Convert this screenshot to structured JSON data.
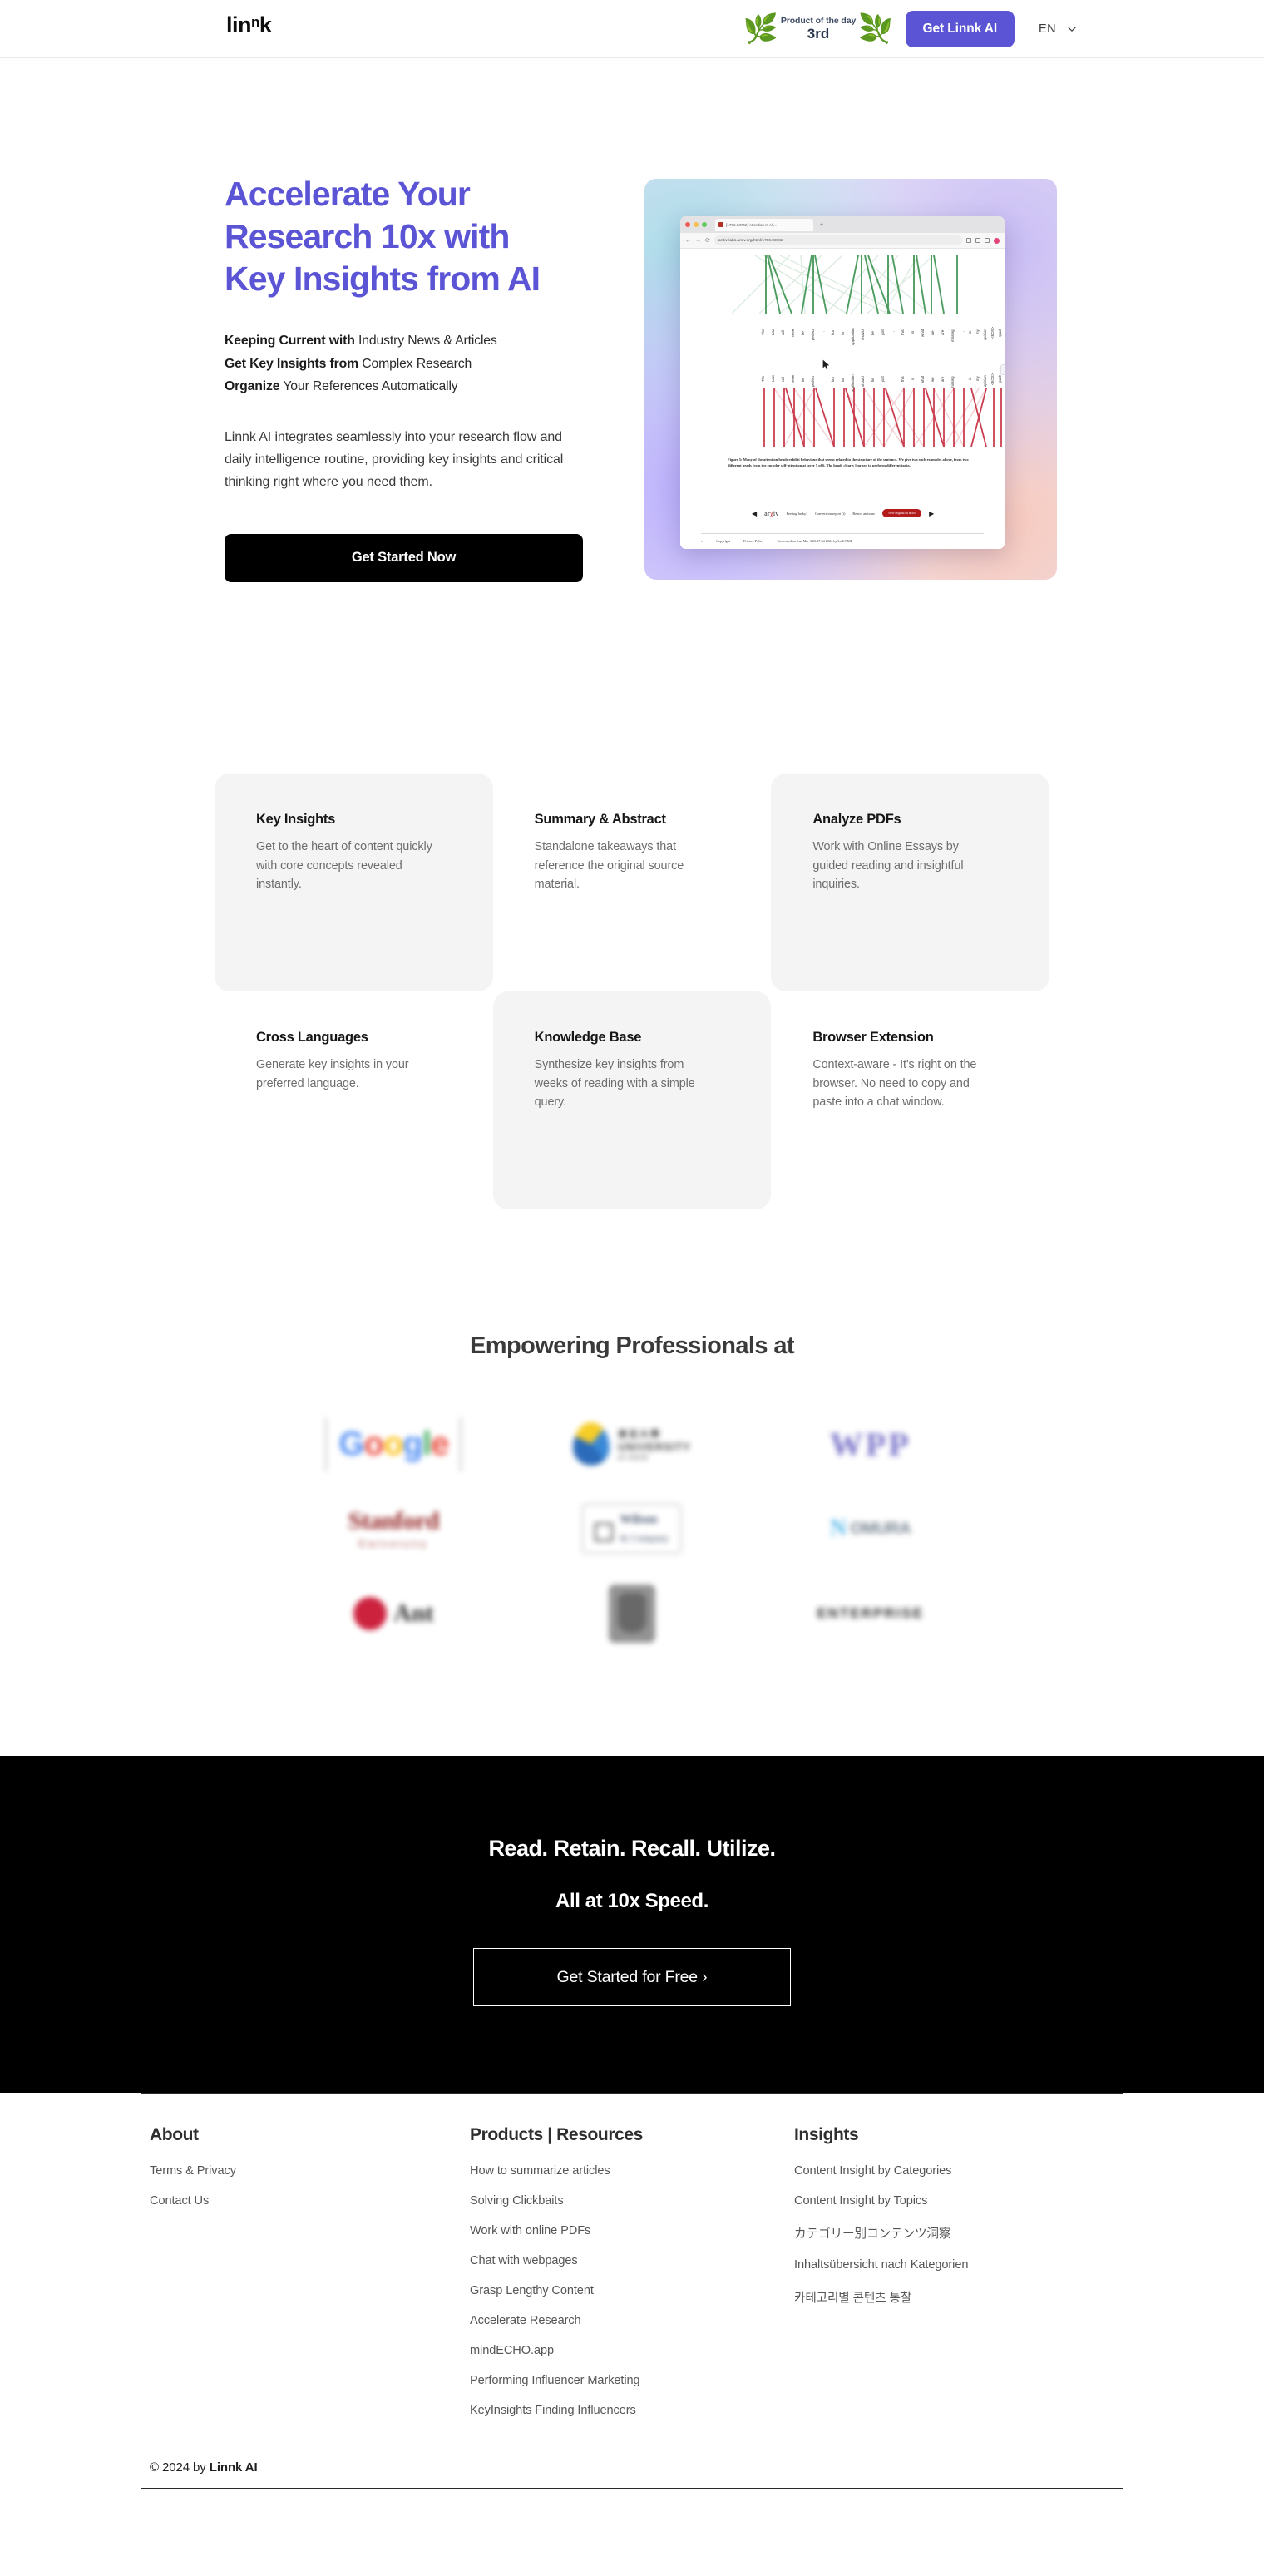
{
  "header": {
    "logo": {
      "pre": "lin",
      "sup": "n",
      "post": "k"
    },
    "badge": {
      "title": "Product of the day",
      "rank": "3rd"
    },
    "cta_label": "Get Linnk AI",
    "lang": "EN",
    "chevron_icon": "chevron-down-icon"
  },
  "hero": {
    "heading_line1": "Accelerate Your",
    "heading_line2": "Research 10x with",
    "heading_line3": "Key Insights from AI",
    "bullets": [
      {
        "bold": "Keeping Current with",
        "rest": " Industry News & Articles"
      },
      {
        "bold": "Get Key Insights from",
        "rest": " Complex Research"
      },
      {
        "bold": "Organize",
        "rest": " Your References Automatically"
      }
    ],
    "body": "Linnk AI integrates seamlessly into your research flow and daily intelligence routine, providing key insights and critical thinking right where you need them.",
    "cta_label": "Get Started Now",
    "screenshot": {
      "tab_title": "[1706.03762] Attention Is All...",
      "url": "arXiv-labs.arxiv.org/html/1706.03762",
      "figure_caption": "Figure 5: Many of the attention heads exhibit behaviour that seems related to the structure of the sentence. We give two such examples above, from two different heads from the encoder self-attention at layer 5 of 6. The heads clearly learned to perform different tasks.",
      "tokens": [
        "The",
        "Law",
        "will",
        "never",
        "be",
        "perfect",
        ",",
        "but",
        "its",
        "application",
        "should",
        "be",
        "just",
        ",",
        "this",
        "is",
        "what",
        "we",
        "are",
        "missing",
        ",",
        "in",
        "my",
        "opinion",
        "<EOS>",
        "<pad>"
      ],
      "arxiv_logo": "arXiv",
      "arxiv_links": [
        "Feeling lucky?",
        "Conversion report (i)",
        "Report an issue"
      ],
      "arxiv_button": "View original on arXiv",
      "footer_links": [
        "Copyright",
        "Privacy Policy",
        "Generated on Sun Mar 3 23:17:54 2024 by LaTeXML"
      ]
    }
  },
  "features": [
    {
      "title": "Key Insights",
      "desc": "Get to the heart of content quickly with core concepts revealed instantly.",
      "shaded": true
    },
    {
      "title": "Summary & Abstract",
      "desc": "Standalone takeaways that reference the original source material.",
      "shaded": false
    },
    {
      "title": "Analyze PDFs",
      "desc": "Work with Online Essays by guided reading and insightful inquiries.",
      "shaded": true
    },
    {
      "title": "Cross Languages",
      "desc": "Generate key insights in your preferred language.",
      "shaded": false
    },
    {
      "title": "Knowledge Base",
      "desc": "Synthesize key insights from weeks of reading with a simple query.",
      "shaded": true
    },
    {
      "title": "Browser Extension",
      "desc": "Context-aware - It's right on the browser. No need to copy and paste into a chat window.",
      "shaded": false
    }
  ],
  "logos_section": {
    "title": "Empowering Professionals at",
    "logos": [
      {
        "name": "google-logo"
      },
      {
        "name": "asia-university-logo"
      },
      {
        "name": "wpp-logo"
      },
      {
        "name": "stanford-university-logo"
      },
      {
        "name": "wilson-logo"
      },
      {
        "name": "nomura-logo"
      },
      {
        "name": "johnson-logo"
      },
      {
        "name": "apple-logo"
      },
      {
        "name": "dark-wordmark-logo"
      }
    ]
  },
  "black_cta": {
    "line1": "Read. Retain. Recall. Utilize.",
    "line2": "All at 10x Speed.",
    "button": "Get Started for Free  ›"
  },
  "footer": {
    "columns": [
      {
        "title": "About",
        "links": [
          "Terms & Privacy",
          "Contact Us"
        ]
      },
      {
        "title": "Products | Resources",
        "links": [
          "How to summarize articles",
          "Solving Clickbaits",
          "Work with online PDFs",
          "Chat with webpages",
          "Grasp Lengthy Content",
          "Accelerate Research",
          "mindECHO.app",
          "Performing Influencer Marketing",
          "KeyInsights Finding Influencers"
        ]
      },
      {
        "title": "Insights",
        "links": [
          "Content Insight by Categories",
          "Content Insight by Topics",
          "カテゴリー別コンテンツ洞察",
          "Inhaltsübersicht nach Kategorien",
          "카테고리별 콘텐츠 통찰"
        ]
      }
    ],
    "copyright_prefix": "© 2024 by ",
    "copyright_brand": "Linnk AI"
  },
  "colors": {
    "accent_purple": "#5b55d6",
    "black": "#000000",
    "card_gray": "#f4f4f5"
  }
}
